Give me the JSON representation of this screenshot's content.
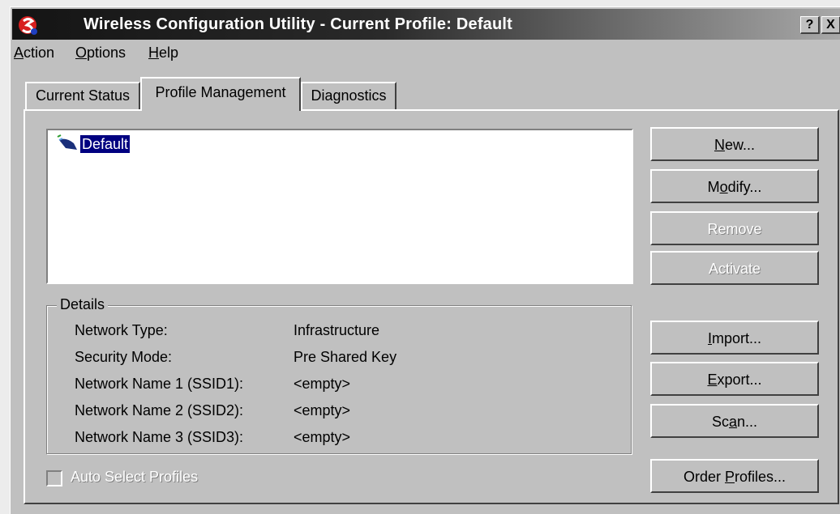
{
  "window": {
    "title": "Wireless Configuration Utility - Current Profile: Default",
    "help_button": "?",
    "close_button": "X"
  },
  "menu": {
    "items": [
      {
        "accel": "A",
        "rest": "ction"
      },
      {
        "accel": "O",
        "rest": "ptions"
      },
      {
        "accel": "H",
        "rest": "elp"
      }
    ]
  },
  "tabs": {
    "current_status": "Current Status",
    "profile_management": "Profile Management",
    "diagnostics": "Diagnostics",
    "active": "profile_management"
  },
  "profiles": {
    "items": [
      {
        "name": "Default",
        "selected": true
      }
    ]
  },
  "buttons": {
    "new": {
      "accel": "N",
      "rest": "ew..."
    },
    "modify": {
      "accel": "o",
      "pre": "M",
      "rest": "dify..."
    },
    "remove": {
      "label": "Remove"
    },
    "activate": {
      "label": "Activate"
    },
    "import": {
      "accel": "I",
      "rest": "mport..."
    },
    "export": {
      "accel": "E",
      "rest": "xport..."
    },
    "scan": {
      "pre": "Sc",
      "accel": "a",
      "rest": "n..."
    },
    "order_profiles": {
      "pre": "Order ",
      "accel": "P",
      "rest": "rofiles..."
    }
  },
  "details": {
    "legend": "Details",
    "rows": [
      {
        "label": "Network Type:",
        "value": "Infrastructure"
      },
      {
        "label": "Security Mode:",
        "value": "Pre Shared Key"
      },
      {
        "label": "Network Name 1 (SSID1):",
        "value": "<empty>"
      },
      {
        "label": "Network Name 2 (SSID2):",
        "value": "<empty>"
      },
      {
        "label": "Network Name 3 (SSID3):",
        "value": "<empty>"
      }
    ]
  },
  "auto_select": {
    "label": "Auto Select Profiles",
    "checked": false,
    "enabled": false
  },
  "colors": {
    "face": "#c0c0c0",
    "selection": "#000080",
    "title_dark": "#141414"
  }
}
